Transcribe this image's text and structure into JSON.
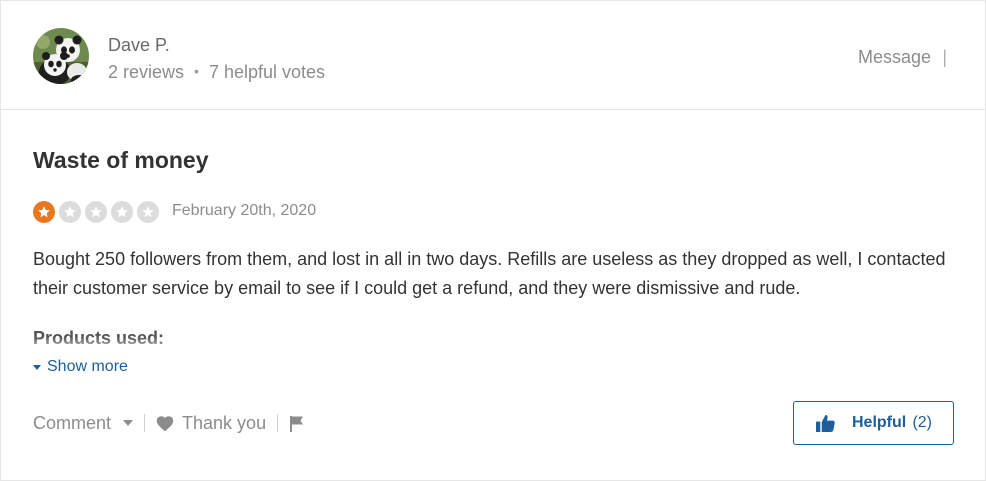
{
  "reviewer": {
    "name": "Dave P.",
    "reviews": "2 reviews",
    "separator": "•",
    "helpful_votes": "7 helpful votes",
    "avatar_icon": "panda-photo-avatar",
    "message_label": "Message",
    "message_separator": "|"
  },
  "review": {
    "title": "Waste of money",
    "rating": 1,
    "max_rating": 5,
    "date": "February 20th, 2020",
    "text": "Bought 250 followers from them, and lost in all in two days. Refills are useless as they dropped as well, I contacted their customer service by email to see if I could get a refund, and they were dismissive and rude.",
    "products_label": "Products used:",
    "show_more_label": "Show more"
  },
  "actions": {
    "comment_label": "Comment",
    "thank_label": "Thank you",
    "flag_icon": "flag-icon",
    "heart_icon": "heart-icon",
    "helpful_label": "Helpful",
    "helpful_count": "(2)"
  },
  "colors": {
    "star_active": "#e87722",
    "star_inactive": "#dcdcdc",
    "link_blue": "#1d5f9a"
  }
}
